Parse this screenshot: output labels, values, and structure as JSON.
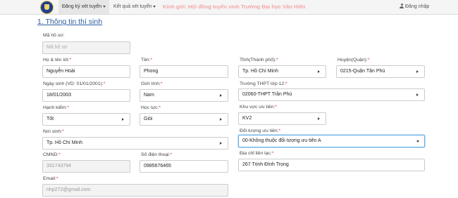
{
  "nav": {
    "register": "Đăng ký xét tuyển",
    "results": "Kết quả xét tuyển",
    "notice": "Kính gửi: Hội đồng tuyển sinh Trường Đại học Văn Hiến",
    "login": "Đăng nhập"
  },
  "section": {
    "title": "1. Thông tin thí sinh"
  },
  "form": {
    "profile_code": {
      "label": "Mã hồ sơ:",
      "placeholder": "Mã hồ sơ"
    },
    "full_name": {
      "label": "Họ & tên lót:",
      "value": "Nguyễn Hoài"
    },
    "first_name": {
      "label": "Tên:",
      "value": "Phong"
    },
    "province": {
      "label": "Tỉnh(Thành phố):",
      "value": "Tp. Hồ Chí Minh"
    },
    "district": {
      "label": "Huyện(Quận):",
      "value": "0215-Quận Tân Phú"
    },
    "dob": {
      "label": "Ngày sinh (VD: 01/01/2001):",
      "value": "18/01/2003"
    },
    "gender": {
      "label": "Giới tính:",
      "value": "Nam"
    },
    "school": {
      "label": "Trường THPT lớp 12:",
      "value": "02060-THPT Trần Phú"
    },
    "conduct": {
      "label": "Hạnh kiểm:",
      "value": "Tốt"
    },
    "academic": {
      "label": "Học lực:",
      "value": "Giỏi"
    },
    "priority_area": {
      "label": "Khu vực ưu tiên:",
      "value": "KV2"
    },
    "birthplace": {
      "label": "Nơi sinh:",
      "value": "Tp. Hồ Chí Minh"
    },
    "priority_subject": {
      "label": "Đối tượng ưu tiên:",
      "value": "00-Không thuộc đối tượng ưu tiên A"
    },
    "id_card": {
      "label": "CMND:",
      "value": "331743794"
    },
    "phone": {
      "label": "Số điện thoại:",
      "value": "0985676465"
    },
    "address": {
      "label": "Địa chỉ liên lạc:",
      "value": "267 Trịnh Đình Trọng"
    },
    "email": {
      "label": "Email:",
      "value": "nhp272@gmail.com"
    }
  }
}
